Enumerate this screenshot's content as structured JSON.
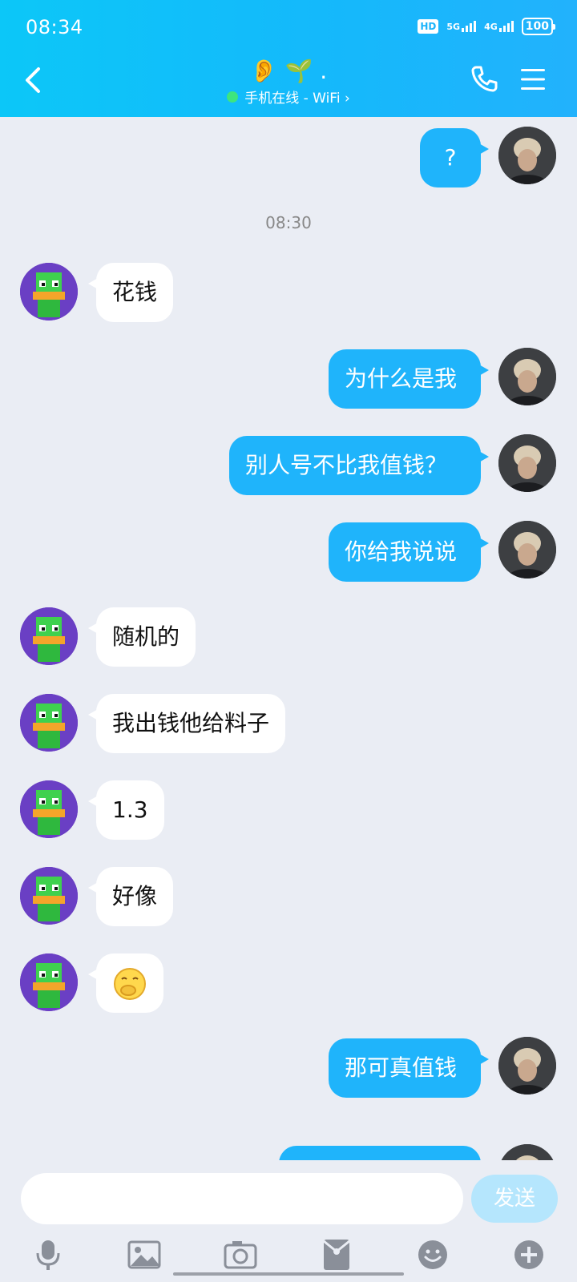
{
  "status_bar": {
    "time": "08:34",
    "hd_label": "HD",
    "sim1": "5G",
    "sim2": "4G",
    "battery": "100"
  },
  "header": {
    "title": "👂 🌱 .",
    "status_text": "手机在线 - WiFi ›"
  },
  "messages": [
    {
      "side": "right",
      "text": "?"
    },
    {
      "type": "time",
      "text": "08:30"
    },
    {
      "side": "left",
      "text": "花钱"
    },
    {
      "side": "right",
      "text": "为什么是我"
    },
    {
      "side": "right",
      "text": "别人号不比我值钱？"
    },
    {
      "side": "right",
      "text": "你给我说说"
    },
    {
      "side": "left",
      "text": "随机的"
    },
    {
      "side": "left",
      "text": "我出钱他给料子"
    },
    {
      "side": "left",
      "text": "1.3"
    },
    {
      "side": "left",
      "text": "好像"
    },
    {
      "side": "left",
      "text": "🤭"
    },
    {
      "side": "right",
      "text": "那可真值钱"
    }
  ],
  "input": {
    "placeholder": "",
    "send_label": "发送"
  },
  "toolbar_icons": [
    "microphone-icon",
    "image-icon",
    "camera-icon",
    "red-packet-icon",
    "emoji-icon",
    "plus-icon"
  ],
  "colors": {
    "header_start": "#0cc7f8",
    "header_end": "#22b2fc",
    "bubble_self": "#1fb4fb",
    "bubble_other": "#ffffff",
    "background": "#eaedf4",
    "online": "#3ee57e"
  }
}
